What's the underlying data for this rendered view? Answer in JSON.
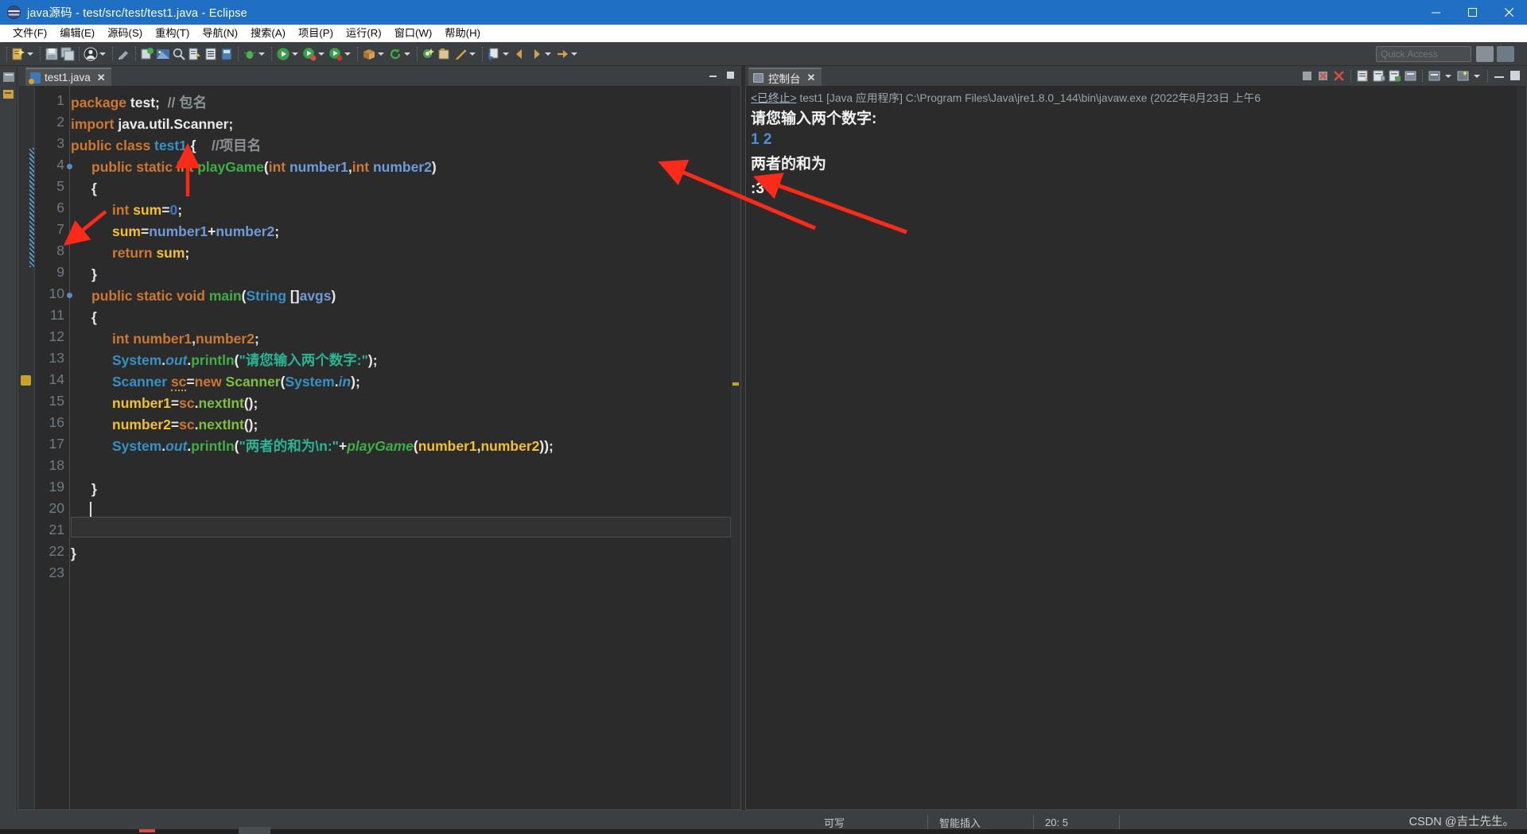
{
  "window": {
    "title": "java源码 - test/src/test/test1.java - Eclipse",
    "app_icon": "eclipse-icon",
    "minimize": "−",
    "maximize": "▢",
    "close": "✕"
  },
  "menubar": {
    "items": [
      {
        "label": "文件(F)",
        "name": "menu-file"
      },
      {
        "label": "编辑(E)",
        "name": "menu-edit"
      },
      {
        "label": "源码(S)",
        "name": "menu-source"
      },
      {
        "label": "重构(T)",
        "name": "menu-refactor"
      },
      {
        "label": "导航(N)",
        "name": "menu-navigate"
      },
      {
        "label": "搜索(A)",
        "name": "menu-search"
      },
      {
        "label": "项目(P)",
        "name": "menu-project"
      },
      {
        "label": "运行(R)",
        "name": "menu-run"
      },
      {
        "label": "窗口(W)",
        "name": "menu-window"
      },
      {
        "label": "帮助(H)",
        "name": "menu-help"
      }
    ]
  },
  "toolbar": {
    "quick_access_placeholder": "Quick Access",
    "quick_access_value": "Quick Access"
  },
  "editor": {
    "tab": {
      "label": "test1.java",
      "close": "✕",
      "icon": "java-file-icon"
    },
    "minimize": "−",
    "maximize": "▢",
    "cursor_line": 20,
    "lines": [
      {
        "n": 1,
        "tokens": [
          {
            "t": "package ",
            "c": "kw"
          },
          {
            "t": "test",
            "c": "id"
          },
          {
            "t": ";",
            "c": "punc"
          },
          {
            "t": "  // 包名",
            "c": "cmt"
          }
        ]
      },
      {
        "n": 2,
        "tokens": [
          {
            "t": "import ",
            "c": "kw"
          },
          {
            "t": "java.util.Scanner;",
            "c": "id"
          }
        ]
      },
      {
        "n": 3,
        "tokens": [
          {
            "t": "public class ",
            "c": "kw"
          },
          {
            "t": "test1",
            "c": "cls"
          },
          {
            "t": " {    ",
            "c": "punc"
          },
          {
            "t": "//项目名",
            "c": "cmt"
          }
        ]
      },
      {
        "n": 4,
        "indent": 1,
        "bp": true,
        "tokens": [
          {
            "t": "public static int ",
            "c": "kw"
          },
          {
            "t": "playGame",
            "c": "mth"
          },
          {
            "t": "(",
            "c": "punc"
          },
          {
            "t": "int ",
            "c": "kw"
          },
          {
            "t": "number1",
            "c": "par"
          },
          {
            "t": ",",
            "c": "punc"
          },
          {
            "t": "int ",
            "c": "kw"
          },
          {
            "t": "number2",
            "c": "par"
          },
          {
            "t": ")",
            "c": "punc"
          }
        ]
      },
      {
        "n": 5,
        "indent": 1,
        "tokens": [
          {
            "t": "{",
            "c": "punc"
          }
        ]
      },
      {
        "n": 6,
        "indent": 2,
        "tokens": [
          {
            "t": "int ",
            "c": "kw"
          },
          {
            "t": "sum",
            "c": "loc"
          },
          {
            "t": "=",
            "c": "punc"
          },
          {
            "t": "0",
            "c": "num"
          },
          {
            "t": ";",
            "c": "punc"
          }
        ]
      },
      {
        "n": 7,
        "indent": 2,
        "tokens": [
          {
            "t": "sum",
            "c": "loc"
          },
          {
            "t": "=",
            "c": "punc"
          },
          {
            "t": "number1",
            "c": "par"
          },
          {
            "t": "+",
            "c": "punc"
          },
          {
            "t": "number2",
            "c": "par"
          },
          {
            "t": ";",
            "c": "punc"
          }
        ]
      },
      {
        "n": 8,
        "indent": 2,
        "tokens": [
          {
            "t": "return ",
            "c": "kw"
          },
          {
            "t": "sum",
            "c": "loc"
          },
          {
            "t": ";",
            "c": "punc"
          }
        ]
      },
      {
        "n": 9,
        "indent": 1,
        "tokens": [
          {
            "t": "}",
            "c": "punc"
          }
        ]
      },
      {
        "n": 10,
        "indent": 1,
        "bp": true,
        "tokens": [
          {
            "t": "public static void ",
            "c": "kw"
          },
          {
            "t": "main",
            "c": "mth"
          },
          {
            "t": "(",
            "c": "punc"
          },
          {
            "t": "String",
            "c": "cls"
          },
          {
            "t": " []",
            "c": "punc"
          },
          {
            "t": "avgs",
            "c": "par"
          },
          {
            "t": ")",
            "c": "punc"
          }
        ]
      },
      {
        "n": 11,
        "indent": 1,
        "tokens": [
          {
            "t": "{",
            "c": "punc"
          }
        ]
      },
      {
        "n": 12,
        "indent": 2,
        "tokens": [
          {
            "t": "int ",
            "c": "kw"
          },
          {
            "t": "number1",
            "c": "kw"
          },
          {
            "t": ",",
            "c": "punc"
          },
          {
            "t": "number2",
            "c": "kw"
          },
          {
            "t": ";",
            "c": "punc"
          }
        ]
      },
      {
        "n": 13,
        "indent": 2,
        "tokens": [
          {
            "t": "System",
            "c": "cls"
          },
          {
            "t": ".",
            "c": "punc"
          },
          {
            "t": "out",
            "c": "fld"
          },
          {
            "t": ".",
            "c": "punc"
          },
          {
            "t": "println",
            "c": "mth"
          },
          {
            "t": "(",
            "c": "punc"
          },
          {
            "t": "\"请您输入两个数字:\"",
            "c": "str"
          },
          {
            "t": ");",
            "c": "punc"
          }
        ]
      },
      {
        "n": 14,
        "indent": 2,
        "warn": true,
        "tokens": [
          {
            "t": "Scanner",
            "c": "cls"
          },
          {
            "t": " ",
            "c": "punc"
          },
          {
            "t": "sc",
            "c": "kw sq"
          },
          {
            "t": "=",
            "c": "punc"
          },
          {
            "t": "new ",
            "c": "kw"
          },
          {
            "t": "Scanner",
            "c": "mth2"
          },
          {
            "t": "(",
            "c": "punc"
          },
          {
            "t": "System",
            "c": "cls"
          },
          {
            "t": ".",
            "c": "punc"
          },
          {
            "t": "in",
            "c": "fld"
          },
          {
            "t": ");",
            "c": "punc"
          }
        ]
      },
      {
        "n": 15,
        "indent": 2,
        "tokens": [
          {
            "t": "number1",
            "c": "loc"
          },
          {
            "t": "=",
            "c": "punc"
          },
          {
            "t": "sc",
            "c": "kw"
          },
          {
            "t": ".",
            "c": "punc"
          },
          {
            "t": "nextInt",
            "c": "mth2"
          },
          {
            "t": "();",
            "c": "punc"
          }
        ]
      },
      {
        "n": 16,
        "indent": 2,
        "tokens": [
          {
            "t": "number2",
            "c": "loc"
          },
          {
            "t": "=",
            "c": "punc"
          },
          {
            "t": "sc",
            "c": "kw"
          },
          {
            "t": ".",
            "c": "punc"
          },
          {
            "t": "nextInt",
            "c": "mth2"
          },
          {
            "t": "();",
            "c": "punc"
          }
        ]
      },
      {
        "n": 17,
        "indent": 2,
        "tokens": [
          {
            "t": "System",
            "c": "cls"
          },
          {
            "t": ".",
            "c": "punc"
          },
          {
            "t": "out",
            "c": "fld"
          },
          {
            "t": ".",
            "c": "punc"
          },
          {
            "t": "println",
            "c": "mth"
          },
          {
            "t": "(",
            "c": "punc"
          },
          {
            "t": "\"两者的和为\\n:\"",
            "c": "str"
          },
          {
            "t": "+",
            "c": "punc"
          },
          {
            "t": "playGame",
            "c": "mthi"
          },
          {
            "t": "(",
            "c": "punc"
          },
          {
            "t": "number1",
            "c": "loc"
          },
          {
            "t": ",",
            "c": "punc"
          },
          {
            "t": "number2",
            "c": "loc"
          },
          {
            "t": "));",
            "c": "punc"
          }
        ]
      },
      {
        "n": 18,
        "tokens": []
      },
      {
        "n": 19,
        "indent": 1,
        "tokens": [
          {
            "t": "}",
            "c": "punc"
          }
        ]
      },
      {
        "n": 20,
        "tokens": []
      },
      {
        "n": 21,
        "tokens": []
      },
      {
        "n": 22,
        "tokens": [
          {
            "t": "}",
            "c": "punc"
          }
        ]
      },
      {
        "n": 23,
        "tokens": []
      }
    ]
  },
  "console": {
    "tab": {
      "label": "控制台",
      "close": "✕",
      "icon": "console-icon"
    },
    "terminated_prefix": "<已终止>",
    "launch_info": "test1 [Java 应用程序] C:\\Program Files\\Java\\jre1.8.0_144\\bin\\javaw.exe  (2022年8月23日 上午6",
    "output": [
      {
        "text": "请您输入两个数字:",
        "kind": "stdout"
      },
      {
        "text": "1 2",
        "kind": "stdin"
      },
      {
        "text": "两者的和为",
        "kind": "stdout"
      },
      {
        "text": ":3",
        "kind": "stdout"
      }
    ]
  },
  "statusbar": {
    "writable": "可写",
    "insert_mode": "智能插入",
    "position": "20:  5",
    "extra": ""
  },
  "watermark": "CSDN @吉士先生。",
  "colors": {
    "title_bar": "#1f6fc4",
    "editor_bg": "#2b2b2b",
    "chrome_bg": "#3c3f41",
    "keyword": "#cc7832",
    "class": "#3592c4",
    "method": "#3faf45",
    "string": "#29b594",
    "local_var": "#f5c02a",
    "parameter": "#6f9bd9",
    "number": "#3b7cc7",
    "comment": "#8b9093",
    "annotation_arrow": "#fb2a19"
  }
}
